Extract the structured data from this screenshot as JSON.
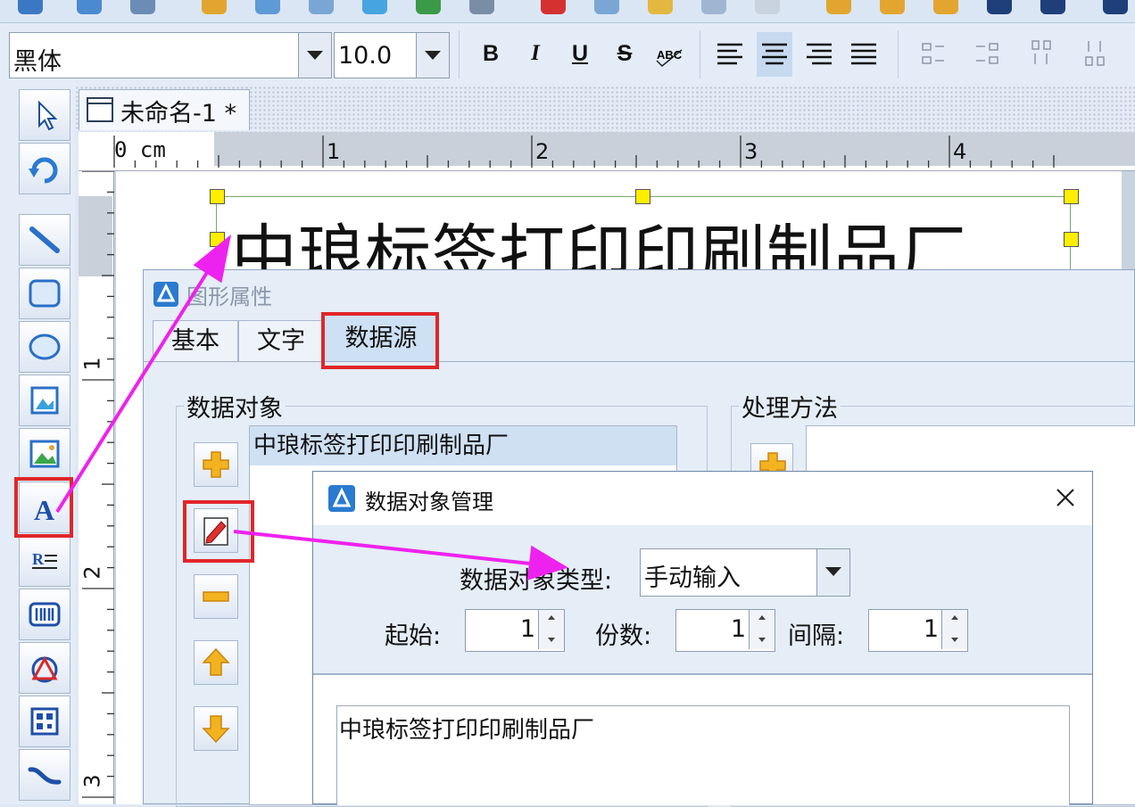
{
  "format_bar": {
    "font_name": "黑体",
    "font_size": "10.0",
    "bold": "B",
    "italic": "I",
    "underline": "U",
    "strike": "S"
  },
  "document": {
    "tab_title": "未命名-1 *",
    "label_text": "中琅标签打印印刷制品厂"
  },
  "ruler": {
    "top_unit_label": "0 cm",
    "top_numbers": [
      "1",
      "2",
      "3",
      "4"
    ],
    "left_numbers": [
      "1",
      "2",
      "3"
    ]
  },
  "props_dialog": {
    "title": "图形属性",
    "tabs": [
      "基本",
      "文字",
      "数据源"
    ],
    "active_tab": "数据源",
    "data_objects_title": "数据对象",
    "data_objects": [
      "中琅标签打印印刷制品厂"
    ],
    "processing_title": "处理方法"
  },
  "dom_dialog": {
    "title": "数据对象管理",
    "type_label": "数据对象类型:",
    "type_value": "手动输入",
    "start_label": "起始:",
    "start_value": "1",
    "copies_label": "份数:",
    "copies_value": "1",
    "interval_label": "间隔:",
    "interval_value": "1",
    "content": "中琅标签打印印刷制品厂"
  },
  "colors": {
    "highlight_border": "#e0262a",
    "arrow": "#ee22ee",
    "selection_handle": "#ffee00"
  }
}
